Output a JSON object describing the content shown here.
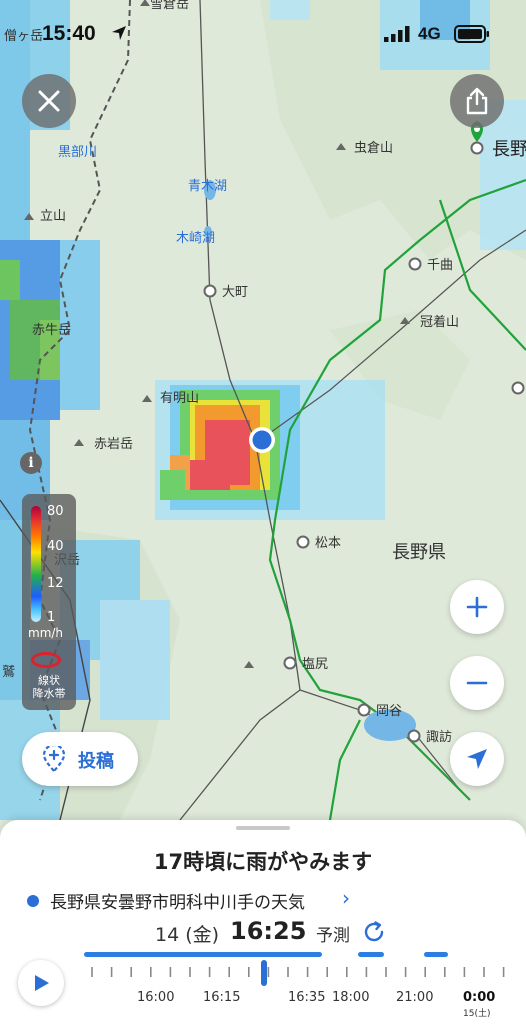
{
  "status_bar": {
    "time": "15:40",
    "network": "4G"
  },
  "map": {
    "places": [
      {
        "name": "雪倉岳",
        "kind": "mountain"
      },
      {
        "name": "僧ヶ岳",
        "kind": "mountain"
      },
      {
        "name": "黒部川",
        "kind": "river"
      },
      {
        "name": "立山",
        "kind": "mountain"
      },
      {
        "name": "赤牛岳",
        "kind": "mountain"
      },
      {
        "name": "有明山",
        "kind": "mountain"
      },
      {
        "name": "赤岩岳",
        "kind": "mountain"
      },
      {
        "name": "青木湖",
        "kind": "lake"
      },
      {
        "name": "木崎湖",
        "kind": "lake"
      },
      {
        "name": "大町",
        "kind": "city"
      },
      {
        "name": "虫倉山",
        "kind": "mountain"
      },
      {
        "name": "長野",
        "kind": "city"
      },
      {
        "name": "千曲",
        "kind": "city"
      },
      {
        "name": "冠着山",
        "kind": "mountain"
      },
      {
        "name": "松本",
        "kind": "city"
      },
      {
        "name": "長野県",
        "kind": "prefecture"
      },
      {
        "name": "塩尻",
        "kind": "city"
      },
      {
        "name": "岡谷",
        "kind": "city"
      },
      {
        "name": "諏訪",
        "kind": "city"
      },
      {
        "name": "沢岳",
        "kind": "mountain"
      },
      {
        "name": "鷲",
        "kind": "mountain"
      }
    ]
  },
  "legend": {
    "ticks": [
      "80",
      "40",
      "12",
      "1"
    ],
    "unit": "mm/h",
    "band_line1": "線状",
    "band_line2": "降水帯"
  },
  "post_button": {
    "label": "投稿"
  },
  "sheet": {
    "headline": "17時頃に雨がやみます",
    "location": "長野県安曇野市明科中川手の天気",
    "chevron": "›",
    "date": "14 (金)",
    "time": "16:25",
    "mode": "予測",
    "timeline_labels": [
      "16:00",
      "16:15",
      "16:35",
      "18:00",
      "21:00",
      "0:00"
    ],
    "timeline_sub": "15(土)"
  },
  "colors": {
    "accent": "#2a6ed6",
    "route_green": "#1fa33a"
  }
}
